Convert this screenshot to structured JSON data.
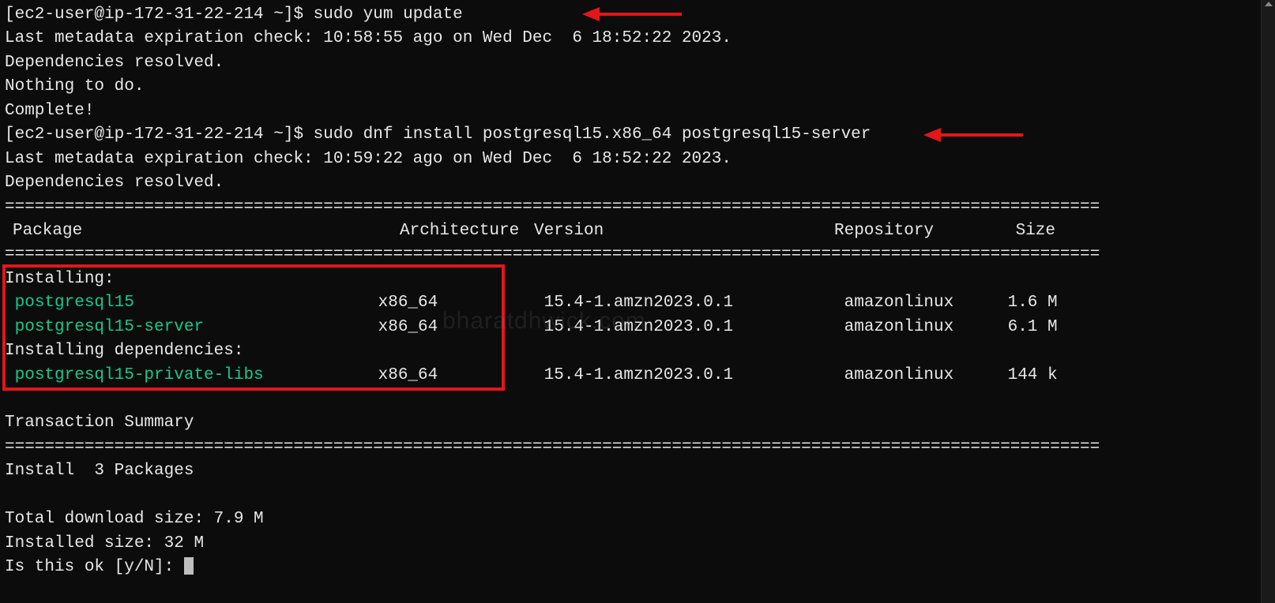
{
  "prompt1": "[ec2-user@ip-172-31-22-214 ~]$ ",
  "cmd1": "sudo yum update",
  "out1_meta": "Last metadata expiration check: 10:58:55 ago on Wed Dec  6 18:52:22 2023.",
  "out1_dep": "Dependencies resolved.",
  "out1_nothing": "Nothing to do.",
  "out1_complete": "Complete!",
  "prompt2": "[ec2-user@ip-172-31-22-214 ~]$ ",
  "cmd2": "sudo dnf install postgresql15.x86_64 postgresql15-server",
  "out2_meta": "Last metadata expiration check: 10:59:22 ago on Wed Dec  6 18:52:22 2023.",
  "out2_dep": "Dependencies resolved.",
  "headers": {
    "pkg": "Package",
    "arch": "Architecture",
    "ver": "Version",
    "repo": "Repository",
    "size": "Size"
  },
  "section_installing": "Installing:",
  "section_deps": "Installing dependencies:",
  "packages": [
    {
      "name": "postgresql15",
      "arch": "x86_64",
      "ver": "15.4-1.amzn2023.0.1",
      "repo": "amazonlinux",
      "size": "1.6 M"
    },
    {
      "name": "postgresql15-server",
      "arch": "x86_64",
      "ver": "15.4-1.amzn2023.0.1",
      "repo": "amazonlinux",
      "size": "6.1 M"
    },
    {
      "name": "postgresql15-private-libs",
      "arch": "x86_64",
      "ver": "15.4-1.amzn2023.0.1",
      "repo": "amazonlinux",
      "size": "144 k"
    }
  ],
  "tx_summary": "Transaction Summary",
  "install_count": "Install  3 Packages",
  "total_dl": "Total download size: 7.9 M",
  "installed_size": "Installed size: 32 M",
  "confirm": "Is this ok [y/N]: ",
  "watermark": "bharatdhwick.com",
  "sep_long": "=============================================================================================================="
}
